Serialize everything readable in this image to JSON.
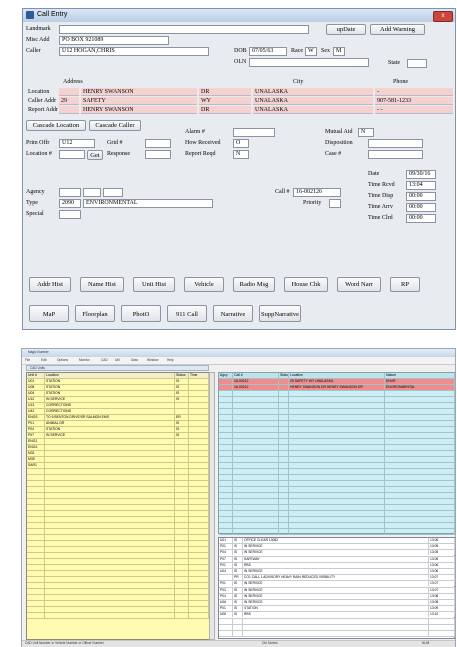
{
  "call_entry": {
    "title": "Call Entry",
    "close": "x",
    "landmark_label": "Landmark",
    "landmark_value": "",
    "misc_addr_label": "Misc Add",
    "misc_addr_value": "PO BOX 921089",
    "caller_label": "Caller",
    "caller_value": "U12 HOGAN,CHRIS",
    "dob_label": "DOB",
    "dob_value": "07/05/63",
    "race_label": "Race",
    "race_value": "W",
    "sex_label": "Sex",
    "sex_value": "M",
    "oln_label": "OLN",
    "state_label": "State",
    "update_button": "upDate",
    "add_warning_button": "Add Warning",
    "address_header": "Address",
    "city_header": "City",
    "phone_header": "Phone",
    "address_rows": [
      {
        "label": "Location",
        "num": "",
        "street": "HENRY SWANSON",
        "type": "DR",
        "city": "UNALASKA",
        "phone": "-"
      },
      {
        "label": "Caller Addr",
        "num": "29",
        "street": "SAFETY",
        "type": "WY",
        "city": "UNALASKA",
        "phone": "907-581-1233"
      },
      {
        "label": "Report Addr",
        "num": "",
        "street": "HENRY SWANSON",
        "type": "DR",
        "city": "UNALASKA",
        "phone": "- -"
      }
    ],
    "cascade_location": "Cascade Location",
    "cascade_caller": "Cascade Caller",
    "alarm_label": "Alarm #",
    "mutual_aid_label": "Mutual Aid",
    "mutual_aid_value": "N",
    "prim_offr_label": "Prim Offr",
    "prim_offr_value": "U12",
    "grid_label": "Grid #",
    "flow_received_label": "How Received",
    "flow_received_value": "O",
    "disposition_label": "Disposition",
    "location_num_label": "Location #",
    "get_button": "Get",
    "response_label": "Response",
    "report_reqd_label": "Report Reqd",
    "report_reqd_value": "N",
    "case_label": "Case #",
    "date_label": "Date",
    "date_value": "09/30/16",
    "time_rcvd_label": "Time Rcvd",
    "time_rcvd_value": "13:04",
    "time_disp_label": "Time Disp",
    "time_disp_value": "00:00",
    "time_arrv_label": "Time Arrv",
    "time_arrv_value": "00:00",
    "time_clrd_label": "Time Clrd",
    "time_clrd_value": "00:00",
    "agency_label": "Agency",
    "type_label": "Type",
    "type_code": "2090",
    "type_desc": "ENVIRONMENTAL",
    "special_label": "Special",
    "call_num_label": "Call #",
    "call_num_value": "16-002126",
    "priority_label": "Priority",
    "buttons_row1": [
      "Addr Hist",
      "Name Hist",
      "Unit Hist",
      "Vehicle",
      "Radio Msg",
      "House Chk",
      "Word Narr",
      "RP"
    ],
    "buttons_row2": [
      "MaP",
      "Floorplan",
      "PhotO",
      "911 Call",
      "Narrative",
      "SuppNarrative"
    ]
  },
  "main_window": {
    "title": "Magic Number",
    "menu": [
      "File",
      "Edit",
      "Options",
      "Monitor",
      "CAD",
      "Util",
      "Data",
      "Window",
      "Help"
    ],
    "left_panel_title": "CAD Units",
    "left_headers": [
      "Unit #",
      "Location",
      "Status",
      "Time"
    ],
    "left_rows": [
      [
        "U01",
        "STATION",
        "IS",
        ""
      ],
      [
        "U08",
        "STATION",
        "IS",
        ""
      ],
      [
        "U04",
        "STATION",
        "IS",
        ""
      ],
      [
        "U12",
        "IN SERVICE",
        "IS",
        ""
      ],
      [
        "U13",
        "CORRECTIONS",
        "",
        ""
      ],
      [
        "U42",
        "CORRECTIONS",
        "",
        ""
      ],
      [
        "ENGS",
        "TO 5 BENTON DRIVE/SR SALMON EMS",
        "ER",
        ""
      ],
      [
        "P01",
        "ANIMAL DR",
        "IS",
        ""
      ],
      [
        "P04",
        "STATION",
        "IS",
        ""
      ],
      [
        "P07",
        "IN SERVICE",
        "IS",
        ""
      ],
      [
        "ENG1",
        "",
        "",
        ""
      ],
      [
        "ENG4",
        "",
        "",
        ""
      ],
      [
        "M31",
        "",
        "",
        ""
      ],
      [
        "M35",
        "",
        "",
        ""
      ],
      [
        "SAR1",
        "",
        "",
        ""
      ]
    ],
    "right_headers": [
      "Agcy",
      "Call #",
      "Status",
      "Location",
      "Nature"
    ],
    "right_rows": [
      [
        "",
        "16-00212",
        "",
        "29 SAFETY WY UNALASKA",
        "ENVR"
      ],
      [
        "",
        "16-00212",
        "",
        "HENRY SWANSON DR HENRY SWANSON DR",
        "ENVIRONMENTAL"
      ]
    ],
    "bottom_rows": [
      [
        "U01",
        "IS",
        "OFFICE CLEAR 13052",
        "13:06"
      ],
      [
        "P01",
        "IS",
        "IN SERVICE",
        "13:05"
      ],
      [
        "P04",
        "IS",
        "IN SERVICE",
        "13:05"
      ],
      [
        "P07",
        "IS",
        "SAFEWAY",
        "13:05"
      ],
      [
        "P01",
        "IS",
        "RBS",
        "13:06"
      ],
      [
        "U04",
        "IS",
        "IN SERVICE",
        "13:06"
      ],
      [
        "",
        "PR",
        "CO1 CALL 1 ADVISORY HEAVY RAIN REDUCED VISIBILITY",
        "13:07"
      ],
      [
        "P01",
        "IS",
        "IN SERVICE",
        "13:07"
      ],
      [
        "P03",
        "IS",
        "IN SERVICE",
        "13:07"
      ],
      [
        "P04",
        "IS",
        "IN SERVICE",
        "13:08"
      ],
      [
        "U06",
        "IS",
        "IN SERVICE",
        "13:08"
      ],
      [
        "P01",
        "IS",
        "STATION",
        "13:09"
      ],
      [
        "U08",
        "IS",
        "RBS",
        "13:10"
      ]
    ],
    "status_left": "CAD Unit Number or Vehicle Number or Officer Number",
    "status_mid": "Ctrl Screen",
    "status_right": "NUM"
  }
}
